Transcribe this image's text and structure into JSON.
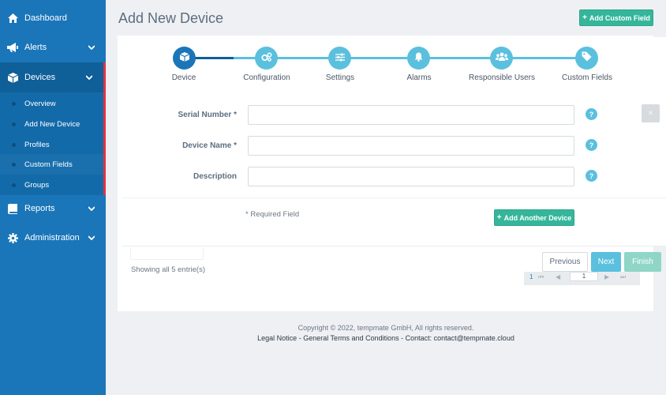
{
  "sidebar": {
    "items": [
      {
        "label": "Dashboard",
        "icon": "home-icon"
      },
      {
        "label": "Alerts",
        "icon": "megaphone-icon"
      },
      {
        "label": "Devices",
        "icon": "cube-icon"
      },
      {
        "label": "Reports",
        "icon": "book-icon"
      },
      {
        "label": "Administration",
        "icon": "gear-icon"
      }
    ],
    "submenu": [
      "Overview",
      "Add New Device",
      "Profiles",
      "Custom Fields",
      "Groups"
    ]
  },
  "header": {
    "title": "Add New Device",
    "add_custom_field": "Add Custom Field"
  },
  "wizard": {
    "steps": [
      {
        "label": "Device",
        "icon": "cube-icon"
      },
      {
        "label": "Configuration",
        "icon": "cogs-icon"
      },
      {
        "label": "Settings",
        "icon": "sliders-icon"
      },
      {
        "label": "Alarms",
        "icon": "bell-icon"
      },
      {
        "label": "Responsible Users",
        "icon": "users-icon"
      },
      {
        "label": "Custom Fields",
        "icon": "tags-icon"
      }
    ],
    "active_step": 0
  },
  "form": {
    "serial_label": "Serial Number *",
    "name_label": "Device Name *",
    "description_label": "Description",
    "serial_value": "",
    "name_value": "",
    "description_value": "",
    "help": "?",
    "close": "×",
    "required_note": "* Required Field",
    "add_another": "Add Another Device"
  },
  "bottom": {
    "showing": "Showing all 5 entrie(s)",
    "previous": "Previous",
    "next": "Next",
    "finish": "Finish",
    "page": "1"
  },
  "footer": {
    "copyright": "Copyright © 2022, tempmate GmbH, All rights reserved.",
    "legal": "Legal Notice",
    "sep1": " - ",
    "terms": "General Terms and Conditions",
    "sep2": " - ",
    "contact_label": "Contact: ",
    "contact_email": "contact@tempmate.cloud"
  },
  "colors": {
    "sidebar": "#1a76b9",
    "accent_green": "#35b69b",
    "step_blue": "#5bc0de",
    "active_border": "#e4343f"
  }
}
